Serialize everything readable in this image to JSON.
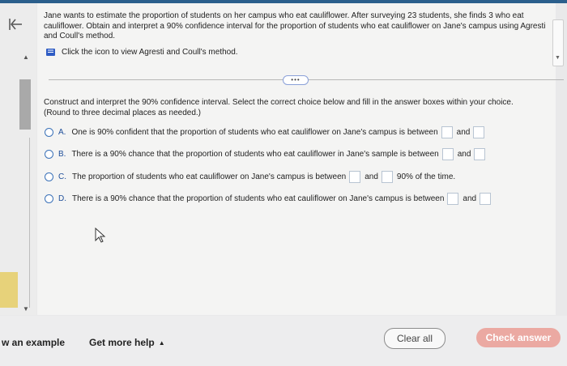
{
  "question": {
    "text": "Jane wants to estimate the proportion of students on her campus who eat cauliflower. After surveying 23 students, she finds 3 who eat cauliflower. Obtain and interpret a 90% confidence interval for the proportion of students who eat cauliflower on Jane's campus using Agresti and Coull's method.",
    "method_link": "Click the icon to view Agresti and Coull's method."
  },
  "instruction": {
    "line1": "Construct and interpret the 90% confidence interval. Select the correct choice below and fill in the answer boxes within your choice.",
    "line2": "(Round to three decimal places as needed.)"
  },
  "choices": [
    {
      "letter": "A.",
      "text": "One is 90% confident that the proportion of students who eat cauliflower on Jane's campus is between",
      "mid": "and",
      "tail": ""
    },
    {
      "letter": "B.",
      "text": "There is a 90% chance that the proportion of students who eat cauliflower in Jane's sample is between",
      "mid": "and",
      "tail": ""
    },
    {
      "letter": "C.",
      "text": "The proportion of students who eat cauliflower on Jane's campus is between",
      "mid": "and",
      "tail": "90% of the time."
    },
    {
      "letter": "D.",
      "text": "There is a 90% chance that the proportion of students who eat cauliflower on Jane's campus is between",
      "mid": "and",
      "tail": ""
    }
  ],
  "ellipsis": "•••",
  "footer": {
    "example": "w an example",
    "more_help": "Get more help",
    "clear": "Clear all",
    "check": "Check answer"
  }
}
